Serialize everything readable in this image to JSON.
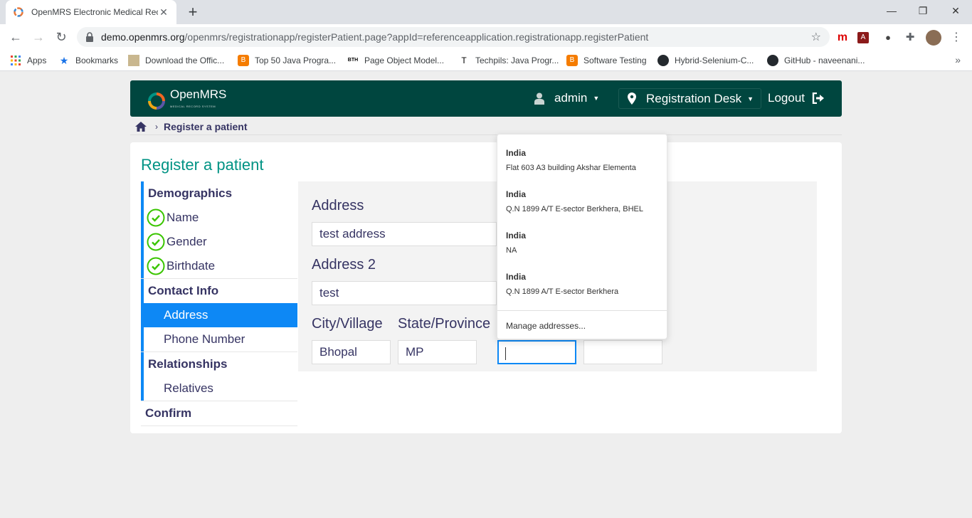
{
  "browser": {
    "tab_title": "OpenMRS Electronic Medical Rec",
    "url_host": "demo.openmrs.org",
    "url_path": "/openmrs/registrationapp/registerPatient.page?appId=referenceapplication.registrationapp.registerPatient",
    "bookmarks": [
      {
        "label": "Apps"
      },
      {
        "label": "Bookmarks"
      },
      {
        "label": "Download the Offic..."
      },
      {
        "label": "Top 50 Java Progra..."
      },
      {
        "label": "Page Object Model..."
      },
      {
        "label": "Techpils: Java Progr..."
      },
      {
        "label": "Software Testing"
      },
      {
        "label": "Hybrid-Selenium-C..."
      },
      {
        "label": "GitHub - naveenani..."
      }
    ]
  },
  "header": {
    "logo_text": "OpenMRS",
    "logo_sub": "MEDICAL RECORD SYSTEM",
    "user": "admin",
    "location": "Registration Desk",
    "logout": "Logout"
  },
  "breadcrumb": {
    "current": "Register a patient"
  },
  "page": {
    "title": "Register a patient"
  },
  "sidebar": {
    "demographics": {
      "heading": "Demographics",
      "items": [
        "Name",
        "Gender",
        "Birthdate"
      ]
    },
    "contact": {
      "heading": "Contact Info",
      "items": [
        "Address",
        "Phone Number"
      ]
    },
    "relationships": {
      "heading": "Relationships",
      "items": [
        "Relatives"
      ]
    },
    "confirm": "Confirm"
  },
  "form": {
    "address_label": "Address",
    "address_value": "test address",
    "address2_label": "Address 2",
    "address2_value": "test",
    "city_label": "City/Village",
    "city_value": "Bhopal",
    "state_label": "State/Province",
    "state_value": "MP",
    "country_value": "",
    "postal_value": ""
  },
  "dropdown": {
    "items": [
      {
        "country": "India",
        "address": "Flat 603 A3 building Akshar Elementa"
      },
      {
        "country": "India",
        "address": "Q.N 1899 A/T E-sector Berkhera, BHEL"
      },
      {
        "country": "India",
        "address": "NA"
      },
      {
        "country": "India",
        "address": "Q.N 1899 A/T E-sector Berkhera"
      }
    ],
    "manage": "Manage addresses..."
  },
  "colors": {
    "header_bg": "#00463f",
    "accent_blue": "#0d88f5",
    "title_teal": "#009384",
    "check_green": "#3ac500"
  }
}
